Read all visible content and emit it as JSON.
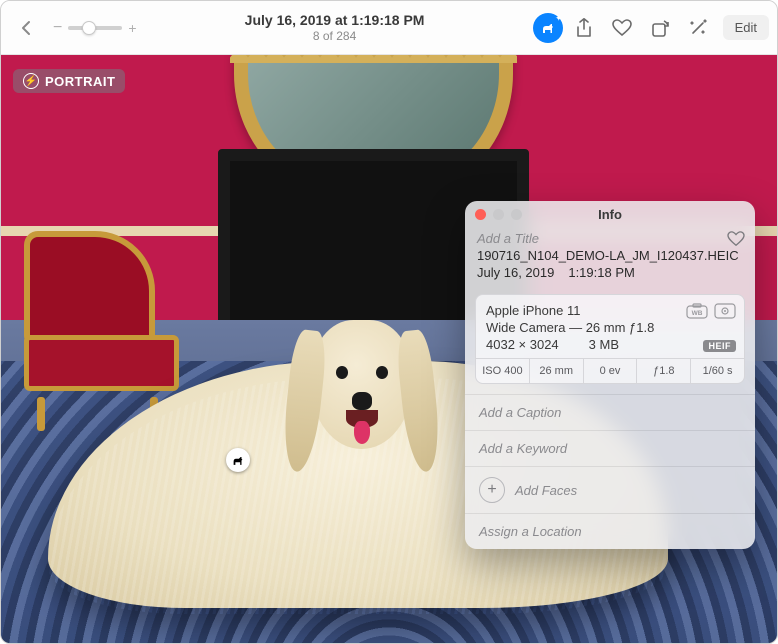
{
  "toolbar": {
    "date_time": "July 16, 2019 at 1:19:18 PM",
    "position": "8 of 284",
    "edit_label": "Edit"
  },
  "badge": {
    "portrait_label": "PORTRAIT"
  },
  "info_panel": {
    "title": "Info",
    "add_title_placeholder": "Add a Title",
    "filename": "190716_N104_DEMO-LA_JM_I120437.HEIC",
    "date": "July 16, 2019",
    "time": "1:19:18 PM",
    "exif": {
      "device": "Apple iPhone 11",
      "lens": "Wide Camera — 26 mm ƒ1.8",
      "dimensions": "4032 × 3024",
      "filesize": "3 MB",
      "format_badge": "HEIF",
      "iso": "ISO 400",
      "focal": "26 mm",
      "ev": "0 ev",
      "aperture": "ƒ1.8",
      "shutter": "1/60 s"
    },
    "add_caption_placeholder": "Add a Caption",
    "add_keyword_placeholder": "Add a Keyword",
    "add_faces_label": "Add Faces",
    "assign_location_placeholder": "Assign a Location"
  }
}
